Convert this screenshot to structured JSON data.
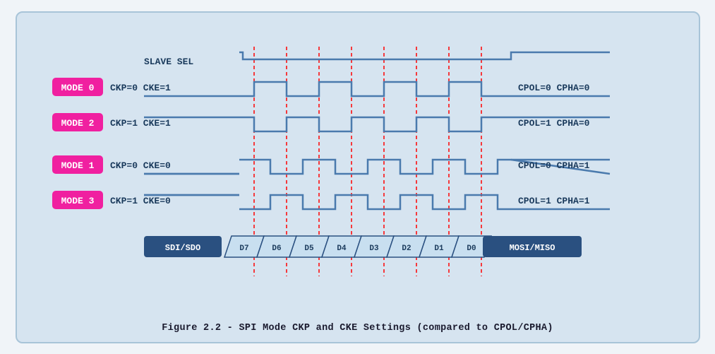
{
  "caption": "Figure 2.2 - SPI Mode CKP and CKE Settings (compared to CPOL/CPHA)",
  "diagram": {
    "slave_sel": "SLAVE SEL",
    "modes": [
      {
        "label": "MODE 0",
        "params": "CKP=0  CKE=1",
        "right": "CPOL=0  CPHA=0"
      },
      {
        "label": "MODE 2",
        "params": "CKP=1  CKE=1",
        "right": "CPOL=1  CPHA=0"
      },
      {
        "label": "MODE 1",
        "params": "CKP=0  CKE=0",
        "right": "CPOL=0  CPHA=1"
      },
      {
        "label": "MODE 3",
        "params": "CKP=1  CKE=0",
        "right": "CPOL=1  CPHA=1"
      }
    ],
    "data_labels": [
      "SDI/SDO",
      "D7",
      "D6",
      "D5",
      "D4",
      "D3",
      "D2",
      "D1",
      "D0",
      "MOSI/MISO"
    ]
  }
}
